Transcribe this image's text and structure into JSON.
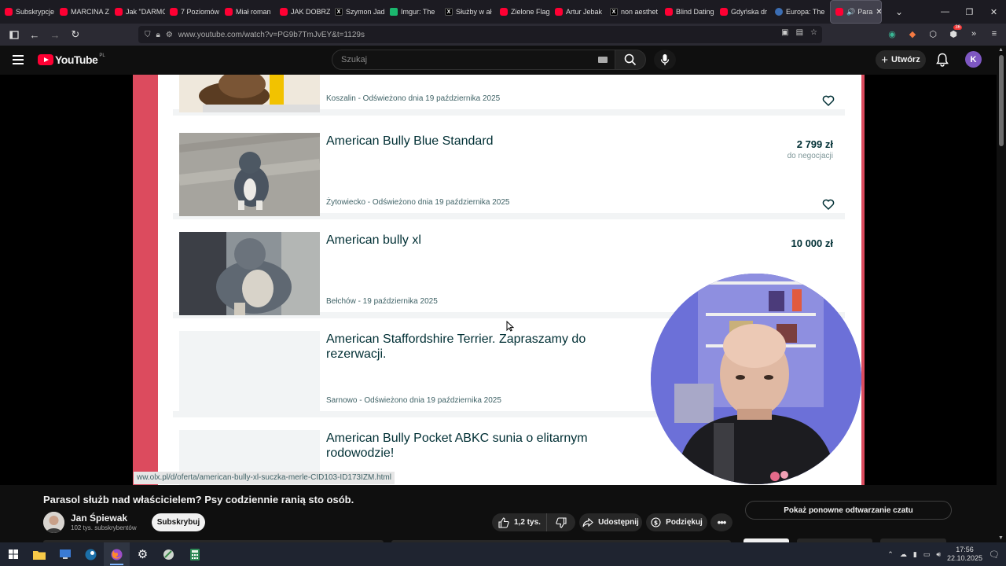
{
  "browser": {
    "tabs": [
      {
        "label": "Subskrypcje",
        "icon": "youtube-icon"
      },
      {
        "label": "MARCINA Z",
        "icon": "youtube-icon"
      },
      {
        "label": "Jak \"DARMO",
        "icon": "youtube-icon"
      },
      {
        "label": "7 Poziomów",
        "icon": "youtube-icon"
      },
      {
        "label": "Miał roman",
        "icon": "youtube-icon"
      },
      {
        "label": "JAK DOBRZ",
        "icon": "youtube-icon"
      },
      {
        "label": "Szymon Jad",
        "icon": "x-icon"
      },
      {
        "label": "Imgur: The",
        "icon": "imgur-icon"
      },
      {
        "label": "Służby w ał",
        "icon": "x-icon"
      },
      {
        "label": "Zielone Flag",
        "icon": "youtube-icon"
      },
      {
        "label": "Artur Jebak",
        "icon": "youtube-icon"
      },
      {
        "label": "non aesthet",
        "icon": "x-icon"
      },
      {
        "label": "Blind Dating",
        "icon": "youtube-icon"
      },
      {
        "label": "Gdyńska dr",
        "icon": "youtube-icon"
      },
      {
        "label": "Europa: The",
        "icon": "globe-icon"
      }
    ],
    "active_tab": {
      "label": "Para",
      "icon": "youtube-icon"
    },
    "url": "www.youtube.com/watch?v=PG9b7TmJvEY&t=1129s",
    "extension_badge": "36"
  },
  "youtube": {
    "logo_text": "YouTube",
    "country_code": "PL",
    "search_placeholder": "Szukaj",
    "create_label": "Utwórz",
    "avatar_letter": "K",
    "avatar_color": "#7e57c2"
  },
  "video_frame": {
    "listings": [
      {
        "title": "",
        "meta": "Koszalin - Odświeżono dnia 19 października 2025",
        "price": "",
        "negotiable": ""
      },
      {
        "title": "American Bully Blue Standard",
        "meta": "Żytowiecko - Odświeżono dnia 19 października 2025",
        "price": "2 799 zł",
        "negotiable": "do negocjacji"
      },
      {
        "title": "American bully xl",
        "meta": "Bełchów - 19 października 2025",
        "price": "10 000 zł",
        "negotiable": ""
      },
      {
        "title": "American Staffordshire Terrier. Zapraszamy do rezerwacji.",
        "meta": "Sarnowo - Odświeżono dnia 19 października 2025",
        "price": "",
        "negotiable": ""
      },
      {
        "title": "American Bully Pocket ABKC sunia o elitarnym rodowodzie!",
        "meta": "",
        "price": "",
        "negotiable": ""
      }
    ],
    "status_url": "ww.olx.pl/d/oferta/american-bully-xl-suczka-merle-CID103-ID173IZM.html",
    "accent_color": "#dc4b5e"
  },
  "video": {
    "title": "Parasol służb nad właścicielem? Psy codziennie ranią sto osób.",
    "channel_name": "Jan Śpiewak",
    "subscribers": "102 tys. subskrybentów",
    "subscribe_label": "Subskrybuj",
    "likes": "1,2 tys.",
    "share_label": "Udostępnij",
    "thanks_label": "Podziękuj",
    "chat_replay_label": "Pokaż ponowne odtwarzanie czatu"
  },
  "taskbar": {
    "time": "17:56",
    "date": "22.10.2025"
  }
}
